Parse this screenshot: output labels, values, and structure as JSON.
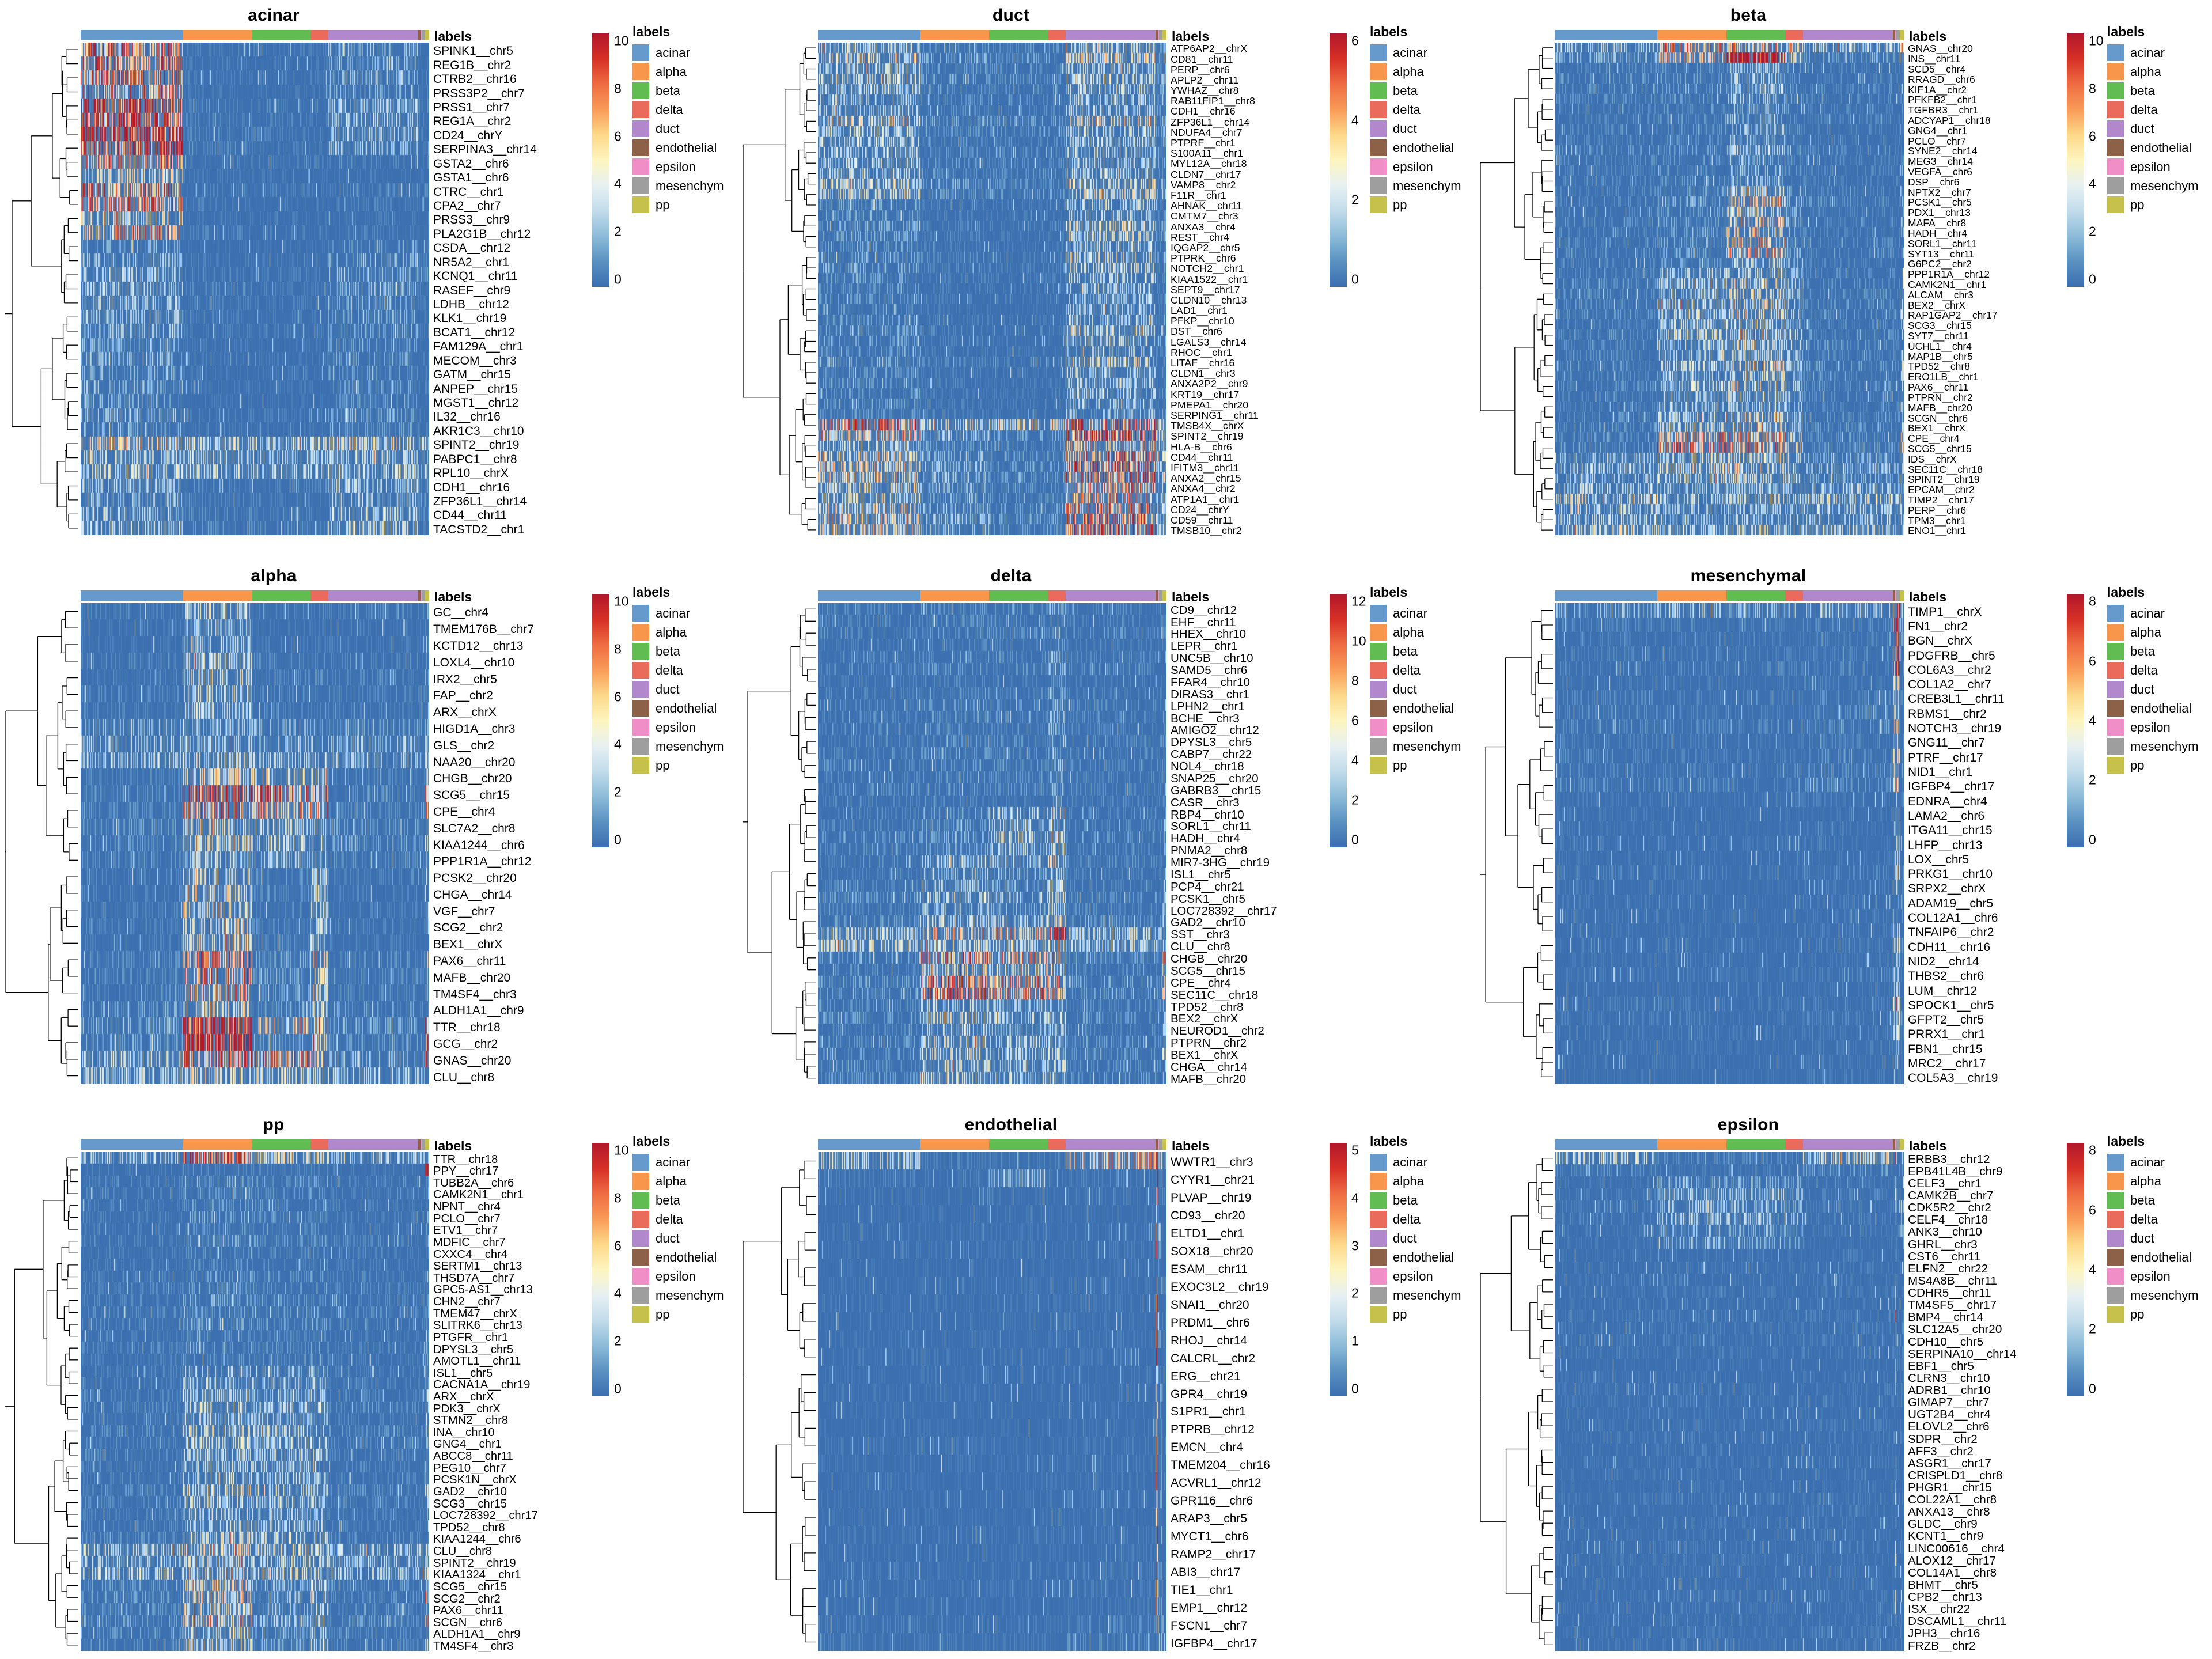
{
  "figure": {
    "legend_title": "labels",
    "anno_label": "labels",
    "cell_types": [
      "acinar",
      "alpha",
      "beta",
      "delta",
      "duct",
      "endothelial",
      "epsilon",
      "mesenchym",
      "pp"
    ],
    "cell_type_colors": [
      "#6699cc",
      "#f8974b",
      "#61bd51",
      "#ea6a5b",
      "#b288cc",
      "#8d6147",
      "#f08ec7",
      "#9e9e9e",
      "#c5c14b"
    ],
    "annotation_fractions": [
      0.293,
      0.198,
      0.169,
      0.051,
      0.258,
      0.006,
      0.003,
      0.01,
      0.012
    ],
    "heatmap_palette": [
      "#3b6fb0",
      "#5a92c2",
      "#8dbcd9",
      "#c2dceb",
      "#e8f1f3",
      "#fdf5c0",
      "#fdd98a",
      "#f99c58",
      "#ef6d43",
      "#d73027",
      "#b2182b"
    ]
  },
  "panels": [
    {
      "title": "acinar",
      "colorbar_ticks": [
        "10",
        "8",
        "6",
        "4",
        "2",
        "0"
      ],
      "colorbar_max": 10,
      "genes": [
        "SPINK1__chr5",
        "REG1B__chr2",
        "CTRB2__chr16",
        "PRSS3P2__chr7",
        "PRSS1__chr7",
        "REG1A__chr2",
        "CD24__chrY",
        "SERPINA3__chr14",
        "GSTA2__chr6",
        "GSTA1__chr6",
        "CTRC__chr1",
        "CPA2__chr7",
        "PRSS3__chr9",
        "PLA2G1B__chr12",
        "CSDA__chr12",
        "NR5A2__chr1",
        "KCNQ1__chr11",
        "RASEF__chr9",
        "LDHB__chr12",
        "KLK1__chr19",
        "BCAT1__chr12",
        "FAM129A__chr1",
        "MECOM__chr3",
        "GATM__chr15",
        "ANPEP__chr15",
        "MGST1__chr12",
        "IL32__chr16",
        "AKR1C3__chr10",
        "SPINT2__chr19",
        "PABPC1__chr8",
        "RPL10__chrX",
        "CDH1__chr16",
        "ZFP36L1__chr14",
        "CD44__chr11",
        "TACSTD2__chr1"
      ]
    },
    {
      "title": "duct",
      "colorbar_ticks": [
        "6",
        "4",
        "2",
        "0"
      ],
      "colorbar_max": 7,
      "genes": [
        "ATP6AP2__chrX",
        "CD81__chr11",
        "PERP__chr6",
        "APLP2__chr11",
        "YWHAZ__chr8",
        "RAB11FIP1__chr8",
        "CDH1__chr16",
        "ZFP36L1__chr14",
        "NDUFA4__chr7",
        "PTPRF__chr1",
        "S100A11__chr1",
        "MYL12A__chr18",
        "CLDN7__chr17",
        "VAMP8__chr2",
        "F11R__chr1",
        "AHNAK__chr11",
        "CMTM7__chr3",
        "ANXA3__chr4",
        "REST__chr4",
        "IQGAP2__chr5",
        "PTPRK__chr6",
        "NOTCH2__chr1",
        "KIAA1522__chr1",
        "SEPT9__chr17",
        "CLDN10__chr13",
        "LAD1__chr1",
        "PFKP__chr10",
        "DST__chr6",
        "LGALS3__chr14",
        "RHOC__chr1",
        "LITAF__chr16",
        "CLDN1__chr3",
        "ANXA2P2__chr9",
        "KRT19__chr17",
        "PMEPA1__chr20",
        "SERPING1__chr11",
        "TMSB4X__chrX",
        "SPINT2__chr19",
        "HLA-B__chr6",
        "CD44__chr11",
        "IFITM3__chr11",
        "ANXA2__chr15",
        "ANXA4__chr2",
        "ATP1A1__chr1",
        "CD24__chrY",
        "CD59__chr11",
        "TMSB10__chr2"
      ]
    },
    {
      "title": "beta",
      "colorbar_ticks": [
        "10",
        "8",
        "6",
        "4",
        "2",
        "0"
      ],
      "colorbar_max": 10,
      "genes": [
        "GNAS__chr20",
        "INS__chr11",
        "SCD5__chr4",
        "RRAGD__chr6",
        "KIF1A__chr2",
        "PFKFB2__chr1",
        "TGFBR3__chr1",
        "ADCYAP1__chr18",
        "GNG4__chr1",
        "PCLO__chr7",
        "SYNE2__chr14",
        "MEG3__chr14",
        "VEGFA__chr6",
        "DSP__chr6",
        "NPTX2__chr7",
        "PCSK1__chr5",
        "PDX1__chr13",
        "MAFA__chr8",
        "HADH__chr4",
        "SORL1__chr11",
        "SYT13__chr11",
        "G6PC2__chr2",
        "PPP1R1A__chr12",
        "CAMK2N1__chr1",
        "ALCAM__chr3",
        "BEX2__chrX",
        "RAP1GAP2__chr17",
        "SCG3__chr15",
        "SYT7__chr11",
        "UCHL1__chr4",
        "MAP1B__chr5",
        "TPD52__chr8",
        "ERO1LB__chr1",
        "PAX6__chr11",
        "PTPRN__chr2",
        "MAFB__chr20",
        "SCGN__chr6",
        "BEX1__chrX",
        "CPE__chr4",
        "SCG5__chr15",
        "IDS__chrX",
        "SEC11C__chr18",
        "SPINT2__chr19",
        "EPCAM__chr2",
        "TIMP2__chr17",
        "PERP__chr6",
        "TPM3__chr1",
        "ENO1__chr1"
      ]
    },
    {
      "title": "alpha",
      "colorbar_ticks": [
        "10",
        "8",
        "6",
        "4",
        "2",
        "0"
      ],
      "colorbar_max": 10,
      "genes": [
        "GC__chr4",
        "TMEM176B__chr7",
        "KCTD12__chr13",
        "LOXL4__chr10",
        "IRX2__chr5",
        "FAP__chr2",
        "ARX__chrX",
        "HIGD1A__chr3",
        "GLS__chr2",
        "NAA20__chr20",
        "CHGB__chr20",
        "SCG5__chr15",
        "CPE__chr4",
        "SLC7A2__chr8",
        "KIAA1244__chr6",
        "PPP1R1A__chr12",
        "PCSK2__chr20",
        "CHGA__chr14",
        "VGF__chr7",
        "SCG2__chr2",
        "BEX1__chrX",
        "PAX6__chr11",
        "MAFB__chr20",
        "TM4SF4__chr3",
        "ALDH1A1__chr9",
        "TTR__chr18",
        "GCG__chr2",
        "GNAS__chr20",
        "CLU__chr8"
      ]
    },
    {
      "title": "delta",
      "colorbar_ticks": [
        "12",
        "10",
        "8",
        "6",
        "4",
        "2",
        "0"
      ],
      "colorbar_max": 12,
      "genes": [
        "CD9__chr12",
        "EHF__chr11",
        "HHEX__chr10",
        "LEPR__chr1",
        "UNC5B__chr10",
        "SAMD5__chr6",
        "FFAR4__chr10",
        "DIRAS3__chr1",
        "LPHN2__chr1",
        "BCHE__chr3",
        "AMIGO2__chr12",
        "DPYSL3__chr5",
        "CABP7__chr22",
        "NOL4__chr18",
        "SNAP25__chr20",
        "GABRB3__chr15",
        "CASR__chr3",
        "RBP4__chr10",
        "SORL1__chr11",
        "HADH__chr4",
        "PNMA2__chr8",
        "MIR7-3HG__chr19",
        "ISL1__chr5",
        "PCP4__chr21",
        "PCSK1__chr5",
        "LOC728392__chr17",
        "GAD2__chr10",
        "SST__chr3",
        "CLU__chr8",
        "CHGB__chr20",
        "SCG5__chr15",
        "CPE__chr4",
        "SEC11C__chr18",
        "TPD52__chr8",
        "BEX2__chrX",
        "NEUROD1__chr2",
        "PTPRN__chr2",
        "BEX1__chrX",
        "CHGA__chr14",
        "MAFB__chr20"
      ]
    },
    {
      "title": "mesenchymal",
      "colorbar_ticks": [
        "8",
        "6",
        "4",
        "2",
        "0"
      ],
      "colorbar_max": 9,
      "genes": [
        "TIMP1__chrX",
        "FN1__chr2",
        "BGN__chrX",
        "PDGFRB__chr5",
        "COL6A3__chr2",
        "COL1A2__chr7",
        "CREB3L1__chr11",
        "RBMS1__chr2",
        "NOTCH3__chr19",
        "GNG11__chr7",
        "PTRF__chr17",
        "NID1__chr1",
        "IGFBP4__chr17",
        "EDNRA__chr4",
        "LAMA2__chr6",
        "ITGA11__chr15",
        "LHFP__chr13",
        "LOX__chr5",
        "PRKG1__chr10",
        "SRPX2__chrX",
        "ADAM19__chr5",
        "COL12A1__chr6",
        "TNFAIP6__chr2",
        "CDH11__chr16",
        "NID2__chr14",
        "THBS2__chr6",
        "LUM__chr12",
        "SPOCK1__chr5",
        "GFPT2__chr5",
        "PRRX1__chr1",
        "FBN1__chr15",
        "MRC2__chr17",
        "COL5A3__chr19"
      ]
    },
    {
      "title": "pp",
      "colorbar_ticks": [
        "10",
        "8",
        "6",
        "4",
        "2",
        "0"
      ],
      "colorbar_max": 10,
      "genes": [
        "TTR__chr18",
        "PPY__chr17",
        "TUBB2A__chr6",
        "CAMK2N1__chr1",
        "NPNT__chr4",
        "PCLO__chr7",
        "ETV1__chr7",
        "MDFIC__chr7",
        "CXXC4__chr4",
        "SERTM1__chr13",
        "THSD7A__chr7",
        "GPC5-AS1__chr13",
        "CHN2__chr7",
        "TMEM47__chrX",
        "SLITRK6__chr13",
        "PTGFR__chr1",
        "DPYSL3__chr5",
        "AMOTL1__chr11",
        "ISL1__chr5",
        "CACNA1A__chr19",
        "ARX__chrX",
        "PDK3__chrX",
        "STMN2__chr8",
        "INA__chr10",
        "GNG4__chr1",
        "ABCC8__chr11",
        "PEG10__chr7",
        "PCSK1N__chrX",
        "GAD2__chr10",
        "SCG3__chr15",
        "LOC728392__chr17",
        "TPD52__chr8",
        "KIAA1244__chr6",
        "CLU__chr8",
        "SPINT2__chr19",
        "KIAA1324__chr1",
        "SCG5__chr15",
        "SCG2__chr2",
        "PAX6__chr11",
        "SCGN__chr6",
        "ALDH1A1__chr9",
        "TM4SF4__chr3"
      ]
    },
    {
      "title": "endothelial",
      "colorbar_ticks": [
        "5",
        "4",
        "3",
        "2",
        "1",
        "0"
      ],
      "colorbar_max": 5.5,
      "genes": [
        "WWTR1__chr3",
        "CYYR1__chr21",
        "PLVAP__chr19",
        "CD93__chr20",
        "ELTD1__chr1",
        "SOX18__chr20",
        "ESAM__chr11",
        "EXOC3L2__chr19",
        "SNAI1__chr20",
        "PRDM1__chr6",
        "RHOJ__chr14",
        "CALCRL__chr2",
        "ERG__chr21",
        "GPR4__chr19",
        "S1PR1__chr1",
        "PTPRB__chr12",
        "EMCN__chr4",
        "TMEM204__chr16",
        "ACVRL1__chr12",
        "GPR116__chr6",
        "ARAP3__chr5",
        "MYCT1__chr6",
        "RAMP2__chr17",
        "ABI3__chr17",
        "TIE1__chr1",
        "EMP1__chr12",
        "FSCN1__chr7",
        "IGFBP4__chr17"
      ]
    },
    {
      "title": "epsilon",
      "colorbar_ticks": [
        "8",
        "6",
        "4",
        "2",
        "0"
      ],
      "colorbar_max": 9,
      "genes": [
        "ERBB3__chr12",
        "EPB41L4B__chr9",
        "CELF3__chr1",
        "CAMK2B__chr7",
        "CDK5R2__chr2",
        "CELF4__chr18",
        "ANK3__chr10",
        "GHRL__chr3",
        "CST6__chr11",
        "ELFN2__chr22",
        "MS4A8B__chr11",
        "CDHR5__chr11",
        "TM4SF5__chr17",
        "BMP4__chr14",
        "SLC12A5__chr20",
        "CDH10__chr5",
        "SERPINA10__chr14",
        "EBF1__chr5",
        "CLRN3__chr10",
        "ADRB1__chr10",
        "GIMAP7__chr7",
        "UGT2B4__chr4",
        "ELOVL2__chr6",
        "SDPR__chr2",
        "AFF3__chr2",
        "ASGR1__chr17",
        "CRISPLD1__chr8",
        "PHGR1__chr15",
        "COL22A1__chr8",
        "ANXA13__chr8",
        "GLDC__chr9",
        "KCNT1__chr9",
        "LINC00616__chr4",
        "ALOX12__chr17",
        "COL14A1__chr8",
        "BHMT__chr5",
        "CPB2__chr13",
        "ISX__chr22",
        "DSCAML1__chr11",
        "JPH3__chr16",
        "FRZB__chr2"
      ]
    }
  ],
  "chart_data": {
    "type": "heatmap",
    "description": "Nine clustered heatmaps of marker-gene expression across pancreatic cell types",
    "column_annotation": "labels",
    "column_groups": [
      "acinar",
      "alpha",
      "beta",
      "delta",
      "duct",
      "endothelial",
      "epsilon",
      "mesenchym",
      "pp"
    ],
    "panel_titles": [
      "acinar",
      "duct",
      "beta",
      "alpha",
      "delta",
      "mesenchymal",
      "pp",
      "endothelial",
      "epsilon"
    ],
    "colorbar_ranges": {
      "acinar": [
        0,
        10
      ],
      "duct": [
        0,
        7
      ],
      "beta": [
        0,
        10
      ],
      "alpha": [
        0,
        10
      ],
      "delta": [
        0,
        12
      ],
      "mesenchymal": [
        0,
        9
      ],
      "pp": [
        0,
        10
      ],
      "endothelial": [
        0,
        5.5
      ],
      "epsilon": [
        0,
        9
      ]
    },
    "gene_counts": {
      "acinar": 35,
      "duct": 47,
      "beta": 48,
      "alpha": 29,
      "delta": 40,
      "mesenchymal": 33,
      "pp": 42,
      "endothelial": 28,
      "epsilon": 41
    },
    "row_clustering": "hierarchical (dendrogram on left)",
    "column_clustering": "none (ordered by cell type annotation)"
  }
}
